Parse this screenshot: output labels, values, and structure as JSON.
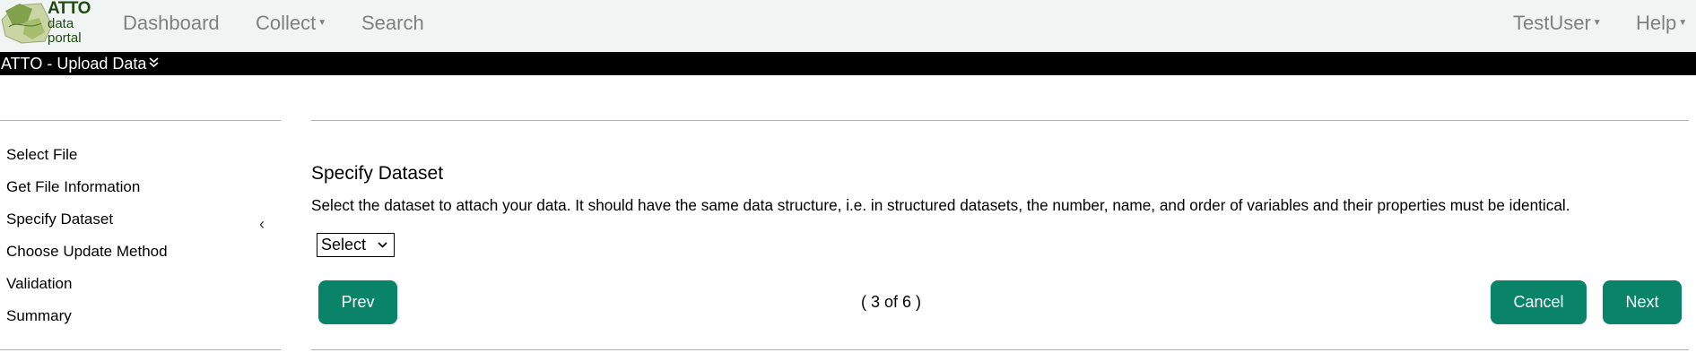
{
  "logo": {
    "title": "ATTO",
    "sub_line1": "data",
    "sub_line2": "portal"
  },
  "nav": {
    "dashboard": "Dashboard",
    "collect": "Collect",
    "search": "Search",
    "user": "TestUser",
    "help": "Help"
  },
  "page_bar": {
    "title": "ATTO - Upload Data"
  },
  "steps": [
    {
      "label": "Select File"
    },
    {
      "label": "Get File Information"
    },
    {
      "label": "Specify Dataset",
      "active": true
    },
    {
      "label": "Choose Update Method"
    },
    {
      "label": "Validation"
    },
    {
      "label": "Summary"
    }
  ],
  "main": {
    "heading": "Specify Dataset",
    "description": "Select the dataset to attach your data. It should have the same data structure, i.e. in structured datasets, the number, name, and order of variables and their properties must be identical.",
    "select_value": "Select",
    "prev_label": "Prev",
    "pager_text": "( 3 of 6 )",
    "cancel_label": "Cancel",
    "next_label": "Next"
  },
  "colors": {
    "primary_button": "#0a8469",
    "nav_background": "#f0f5f3",
    "page_bar_background": "#000000"
  }
}
